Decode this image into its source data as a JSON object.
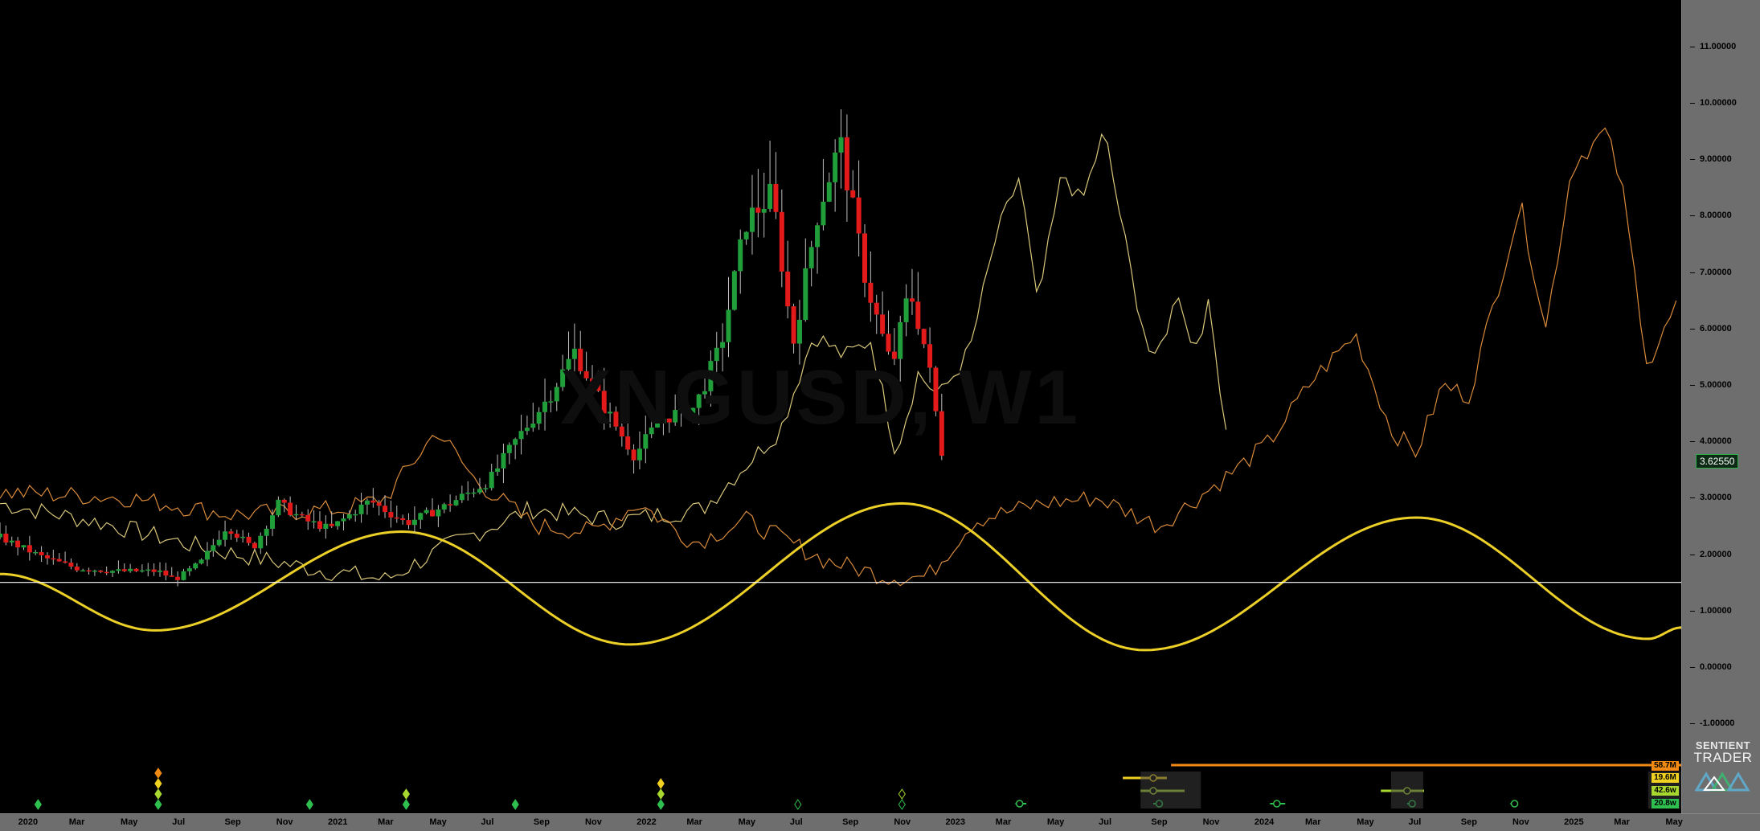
{
  "watermark": "XNGUSD, W1",
  "current_price": "3.62550",
  "logo": {
    "line1": "SENTIENT",
    "line2": "TRADER"
  },
  "colors": {
    "bull": "#1f9e3a",
    "bear": "#e21a1a",
    "wick": "#bdbdbd",
    "composite_a": "#d9c77a",
    "composite_b": "#d88a3a",
    "cycle_wave": "#ecd028",
    "baseline": "#ffffff",
    "c_58": "#f08a14",
    "c_19": "#f0d020",
    "c_42": "#a8d830",
    "c_20": "#2fbf4f"
  },
  "cycle_labels": [
    "58.7M",
    "19.6M",
    "42.6w",
    "20.8w"
  ],
  "chart_data": {
    "type": "candlestick",
    "symbol": "XNGUSD",
    "timeframe": "W1",
    "ylim": [
      -1.5,
      11.6
    ],
    "y_ticks": [
      "11.00000",
      "10.00000",
      "9.00000",
      "8.00000",
      "7.00000",
      "6.00000",
      "5.00000",
      "4.00000",
      "3.00000",
      "2.00000",
      "1.00000",
      "0.00000",
      "-1.00000"
    ],
    "y_values": [
      11,
      10,
      9,
      8,
      7,
      6,
      5,
      4,
      3,
      2,
      1,
      0,
      -1
    ],
    "x_range": [
      "2019-12-01",
      "2025-05-10"
    ],
    "x_ticks": [
      {
        "label": "2020",
        "date": "2020-01-01"
      },
      {
        "label": "Mar",
        "date": "2020-03-01"
      },
      {
        "label": "May",
        "date": "2020-05-01"
      },
      {
        "label": "Jul",
        "date": "2020-07-01"
      },
      {
        "label": "Sep",
        "date": "2020-09-01"
      },
      {
        "label": "Nov",
        "date": "2020-11-01"
      },
      {
        "label": "2021",
        "date": "2021-01-01"
      },
      {
        "label": "Mar",
        "date": "2021-03-01"
      },
      {
        "label": "May",
        "date": "2021-05-01"
      },
      {
        "label": "Jul",
        "date": "2021-07-01"
      },
      {
        "label": "Sep",
        "date": "2021-09-01"
      },
      {
        "label": "Nov",
        "date": "2021-11-01"
      },
      {
        "label": "2022",
        "date": "2022-01-01"
      },
      {
        "label": "Mar",
        "date": "2022-03-01"
      },
      {
        "label": "May",
        "date": "2022-05-01"
      },
      {
        "label": "Jul",
        "date": "2022-07-01"
      },
      {
        "label": "Sep",
        "date": "2022-09-01"
      },
      {
        "label": "Nov",
        "date": "2022-11-01"
      },
      {
        "label": "2023",
        "date": "2023-01-01"
      },
      {
        "label": "Mar",
        "date": "2023-03-01"
      },
      {
        "label": "May",
        "date": "2023-05-01"
      },
      {
        "label": "Jul",
        "date": "2023-07-01"
      },
      {
        "label": "Sep",
        "date": "2023-09-01"
      },
      {
        "label": "Nov",
        "date": "2023-11-01"
      },
      {
        "label": "2024",
        "date": "2024-01-01"
      },
      {
        "label": "Mar",
        "date": "2024-03-01"
      },
      {
        "label": "May",
        "date": "2024-05-01"
      },
      {
        "label": "Jul",
        "date": "2024-07-01"
      },
      {
        "label": "Sep",
        "date": "2024-09-01"
      },
      {
        "label": "Nov",
        "date": "2024-11-01"
      },
      {
        "label": "2025",
        "date": "2025-01-01"
      },
      {
        "label": "Mar",
        "date": "2025-03-01"
      },
      {
        "label": "May",
        "date": "2025-05-01"
      }
    ],
    "close_path": [
      {
        "date": "2019-12-01",
        "close": 2.3
      },
      {
        "date": "2020-01-20",
        "close": 1.95
      },
      {
        "date": "2020-03-01",
        "close": 1.75
      },
      {
        "date": "2020-04-15",
        "close": 1.7
      },
      {
        "date": "2020-06-05",
        "close": 1.7
      },
      {
        "date": "2020-06-25",
        "close": 1.55
      },
      {
        "date": "2020-07-25",
        "close": 1.85
      },
      {
        "date": "2020-08-25",
        "close": 2.5
      },
      {
        "date": "2020-09-25",
        "close": 2.1
      },
      {
        "date": "2020-10-25",
        "close": 2.9
      },
      {
        "date": "2020-11-25",
        "close": 2.6
      },
      {
        "date": "2020-12-25",
        "close": 2.45
      },
      {
        "date": "2021-02-10",
        "close": 2.95
      },
      {
        "date": "2021-03-25",
        "close": 2.55
      },
      {
        "date": "2021-05-10",
        "close": 2.85
      },
      {
        "date": "2021-07-01",
        "close": 3.3
      },
      {
        "date": "2021-08-01",
        "close": 4.0
      },
      {
        "date": "2021-09-10",
        "close": 4.8
      },
      {
        "date": "2021-10-10",
        "close": 5.6
      },
      {
        "date": "2021-11-10",
        "close": 4.7
      },
      {
        "date": "2021-12-20",
        "close": 3.75
      },
      {
        "date": "2022-01-20",
        "close": 4.4
      },
      {
        "date": "2022-03-01",
        "close": 4.6
      },
      {
        "date": "2022-04-01",
        "close": 5.7
      },
      {
        "date": "2022-05-01",
        "close": 7.9
      },
      {
        "date": "2022-06-01",
        "close": 8.4
      },
      {
        "date": "2022-06-25",
        "close": 5.7
      },
      {
        "date": "2022-07-25",
        "close": 8.1
      },
      {
        "date": "2022-08-20",
        "close": 9.3
      },
      {
        "date": "2022-09-20",
        "close": 6.8
      },
      {
        "date": "2022-10-20",
        "close": 5.3
      },
      {
        "date": "2022-11-10",
        "close": 6.7
      },
      {
        "date": "2022-12-01",
        "close": 5.5
      },
      {
        "date": "2022-12-20",
        "close": 3.62
      }
    ],
    "last_close": 3.6255,
    "series": [
      {
        "values": [
          {
            "date": "2019-12-01",
            "y": 2.9
          },
          {
            "date": "2020-04-01",
            "y": 2.55
          },
          {
            "date": "2020-08-01",
            "y": 2.1
          },
          {
            "date": "2020-12-01",
            "y": 1.75
          },
          {
            "date": "2021-03-01",
            "y": 1.55
          },
          {
            "date": "2021-05-20",
            "y": 2.2
          },
          {
            "date": "2021-08-20",
            "y": 2.8
          },
          {
            "date": "2021-12-01",
            "y": 2.6
          },
          {
            "date": "2022-03-10",
            "y": 2.8
          },
          {
            "date": "2022-06-10",
            "y": 4.2
          },
          {
            "date": "2022-07-20",
            "y": 5.9
          },
          {
            "date": "2022-08-25",
            "y": 5.5
          },
          {
            "date": "2022-09-25",
            "y": 5.8
          },
          {
            "date": "2022-10-25",
            "y": 3.8
          },
          {
            "date": "2022-11-20",
            "y": 5.2
          },
          {
            "date": "2022-12-15",
            "y": 4.8
          },
          {
            "date": "2023-01-20",
            "y": 5.6
          },
          {
            "date": "2023-02-20",
            "y": 7.6
          },
          {
            "date": "2023-03-20",
            "y": 8.7
          },
          {
            "date": "2023-04-10",
            "y": 6.4
          },
          {
            "date": "2023-05-10",
            "y": 8.8
          },
          {
            "date": "2023-06-01",
            "y": 8.2
          },
          {
            "date": "2023-06-28",
            "y": 9.5
          },
          {
            "date": "2023-08-01",
            "y": 6.8
          },
          {
            "date": "2023-08-25",
            "y": 5.3
          },
          {
            "date": "2023-09-25",
            "y": 6.7
          },
          {
            "date": "2023-10-10",
            "y": 5.6
          },
          {
            "date": "2023-10-30",
            "y": 6.4
          },
          {
            "date": "2023-11-25",
            "y": 3.6
          }
        ]
      },
      {
        "values": [
          {
            "date": "2019-12-01",
            "y": 3.1
          },
          {
            "date": "2020-05-01",
            "y": 3.0
          },
          {
            "date": "2020-09-01",
            "y": 2.7
          },
          {
            "date": "2021-01-10",
            "y": 2.8
          },
          {
            "date": "2021-03-01",
            "y": 3.0
          },
          {
            "date": "2021-05-01",
            "y": 4.2
          },
          {
            "date": "2021-06-15",
            "y": 3.3
          },
          {
            "date": "2021-08-25",
            "y": 2.5
          },
          {
            "date": "2021-11-01",
            "y": 2.4
          },
          {
            "date": "2021-12-25",
            "y": 2.9
          },
          {
            "date": "2022-03-01",
            "y": 2.2
          },
          {
            "date": "2022-05-01",
            "y": 2.6
          },
          {
            "date": "2022-08-01",
            "y": 1.9
          },
          {
            "date": "2022-10-15",
            "y": 1.6
          },
          {
            "date": "2022-12-01",
            "y": 1.6
          },
          {
            "date": "2023-01-25",
            "y": 2.6
          },
          {
            "date": "2023-04-15",
            "y": 2.9
          },
          {
            "date": "2023-06-20",
            "y": 3.0
          },
          {
            "date": "2023-09-01",
            "y": 2.5
          },
          {
            "date": "2023-12-01",
            "y": 3.5
          },
          {
            "date": "2024-01-10",
            "y": 4.0
          },
          {
            "date": "2024-03-01",
            "y": 5.1
          },
          {
            "date": "2024-04-20",
            "y": 5.9
          },
          {
            "date": "2024-06-01",
            "y": 4.2
          },
          {
            "date": "2024-07-01",
            "y": 3.8
          },
          {
            "date": "2024-08-01",
            "y": 5.0
          },
          {
            "date": "2024-09-01",
            "y": 4.8
          },
          {
            "date": "2024-11-01",
            "y": 8.2
          },
          {
            "date": "2024-12-01",
            "y": 6.0
          },
          {
            "date": "2025-01-01",
            "y": 8.9
          },
          {
            "date": "2025-02-10",
            "y": 9.5
          },
          {
            "date": "2025-03-01",
            "y": 8.5
          },
          {
            "date": "2025-04-01",
            "y": 5.3
          },
          {
            "date": "2025-05-10",
            "y": 6.6
          }
        ]
      }
    ],
    "cycle_wave": {
      "troughs_peaks": [
        {
          "date": "2019-12-01",
          "y": 1.65
        },
        {
          "date": "2020-06-01",
          "y": 0.65
        },
        {
          "date": "2021-03-20",
          "y": 2.4
        },
        {
          "date": "2021-12-15",
          "y": 0.4
        },
        {
          "date": "2022-11-01",
          "y": 2.9
        },
        {
          "date": "2023-08-15",
          "y": 0.3
        },
        {
          "date": "2024-07-01",
          "y": 2.65
        },
        {
          "date": "2025-04-01",
          "y": 0.5
        },
        {
          "date": "2025-05-10",
          "y": 0.7
        }
      ]
    },
    "baseline": 1.5,
    "cycle_lines": [
      {
        "label": "58.7M",
        "start": "2023-09-15",
        "end": "2025-05-10"
      },
      {
        "label": "19.6M",
        "start": "2023-07-20",
        "end": "2023-09-10"
      }
    ]
  }
}
